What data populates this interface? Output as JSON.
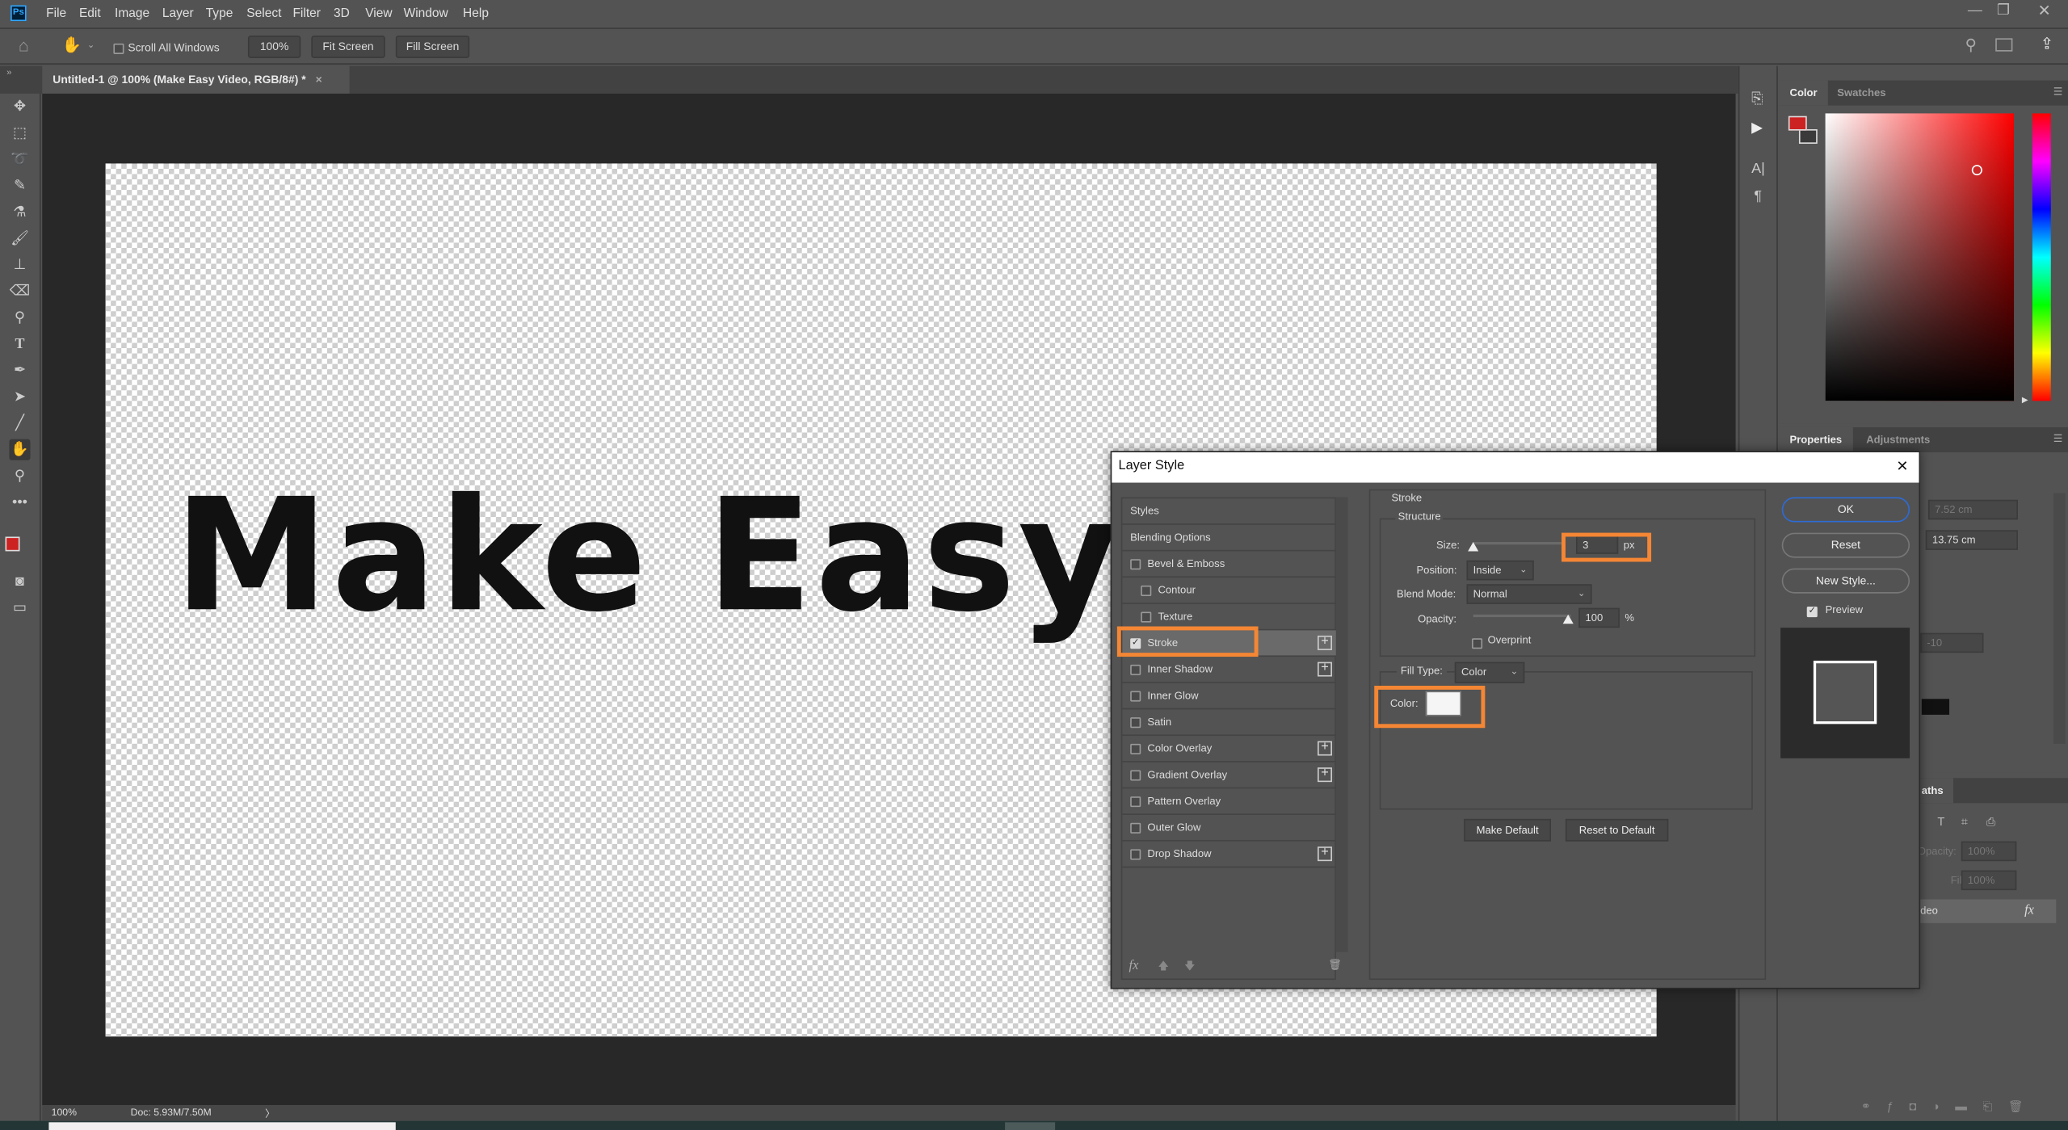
{
  "app": {
    "logo": "Ps",
    "menu": [
      "File",
      "Edit",
      "Image",
      "Layer",
      "Type",
      "Select",
      "Filter",
      "3D",
      "View",
      "Window",
      "Help"
    ],
    "window_controls": [
      "minimize-icon",
      "restore-icon",
      "close-icon"
    ]
  },
  "options_bar": {
    "scroll_all_windows": "Scroll All Windows",
    "scroll_all_checked": false,
    "zoom_100": "100%",
    "fit_screen": "Fit Screen",
    "fill_screen": "Fill Screen"
  },
  "document": {
    "tab_title": "Untitled-1 @ 100% (Make Easy Video, RGB/8#) *",
    "close": "×",
    "canvas_text": "Make Easy Video"
  },
  "status": {
    "zoom": "100%",
    "doc": "Doc: 5.93M/7.50M",
    "arrow": "〉"
  },
  "color_panel": {
    "tabs": [
      "Color",
      "Swatches"
    ],
    "foreground": "#cc2222",
    "background": "#3a3a3a"
  },
  "properties_panel": {
    "tabs": [
      "Properties",
      "Adjustments"
    ],
    "values": [
      "7.52 cm",
      "13.75 cm",
      "-10"
    ]
  },
  "layers_panel": {
    "tab": "aths",
    "opacity_label": "Opacity:",
    "opacity": "100%",
    "fill_label": "Fill:",
    "fill": "100%",
    "layer_name": "deo",
    "fx": "fx"
  },
  "dialog": {
    "title": "Layer Style",
    "close": "✕",
    "styles": [
      {
        "label": "Styles",
        "checkbox": false,
        "plus": false
      },
      {
        "label": "Blending Options",
        "checkbox": false,
        "plus": false
      },
      {
        "label": "Bevel & Emboss",
        "checkbox": true,
        "checked": false,
        "plus": false
      },
      {
        "label": "Contour",
        "checkbox": true,
        "checked": false,
        "plus": false,
        "indent": true
      },
      {
        "label": "Texture",
        "checkbox": true,
        "checked": false,
        "plus": false,
        "indent": true
      },
      {
        "label": "Stroke",
        "checkbox": true,
        "checked": true,
        "plus": true,
        "selected": true
      },
      {
        "label": "Inner Shadow",
        "checkbox": true,
        "checked": false,
        "plus": true
      },
      {
        "label": "Inner Glow",
        "checkbox": true,
        "checked": false,
        "plus": false
      },
      {
        "label": "Satin",
        "checkbox": true,
        "checked": false,
        "plus": false
      },
      {
        "label": "Color Overlay",
        "checkbox": true,
        "checked": false,
        "plus": true
      },
      {
        "label": "Gradient Overlay",
        "checkbox": true,
        "checked": false,
        "plus": true
      },
      {
        "label": "Pattern Overlay",
        "checkbox": true,
        "checked": false,
        "plus": false
      },
      {
        "label": "Outer Glow",
        "checkbox": true,
        "checked": false,
        "plus": false
      },
      {
        "label": "Drop Shadow",
        "checkbox": true,
        "checked": false,
        "plus": true
      }
    ],
    "section": "Stroke",
    "structure": "Structure",
    "size_label": "Size:",
    "size": "3",
    "size_unit": "px",
    "position_label": "Position:",
    "position": "Inside",
    "blend_label": "Blend Mode:",
    "blend": "Normal",
    "opacity_label": "Opacity:",
    "opacity": "100",
    "opacity_unit": "%",
    "overprint": "Overprint",
    "fill_type_label": "Fill Type:",
    "fill_type": "Color",
    "color_label": "Color:",
    "stroke_color": "#f5f5f5",
    "make_default": "Make Default",
    "reset_default": "Reset to Default",
    "ok": "OK",
    "reset": "Reset",
    "new_style": "New Style...",
    "preview": "Preview",
    "preview_checked": true,
    "fx": "fx",
    "highlight_color": "#f58634"
  }
}
